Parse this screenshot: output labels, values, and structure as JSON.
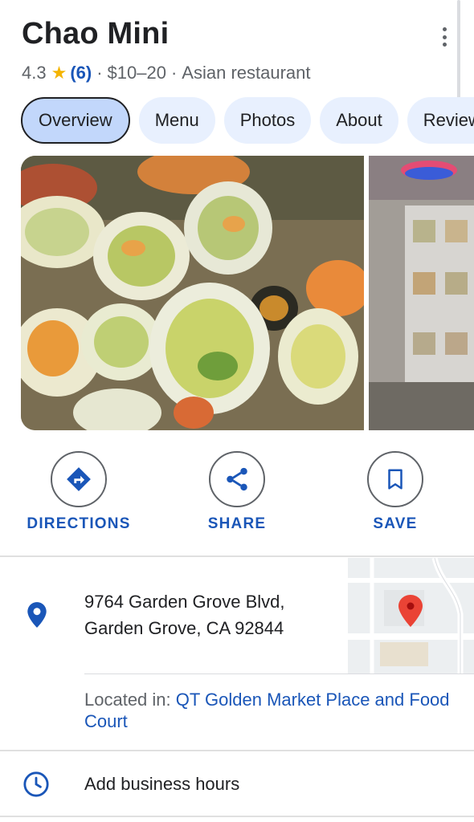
{
  "place": {
    "name": "Chao Mini",
    "rating": "4.3",
    "rating_star": "★",
    "review_count": "(6)",
    "separator": "·",
    "price_range": "$10–20",
    "category": "Asian restaurant"
  },
  "tabs": [
    {
      "label": "Overview",
      "active": true
    },
    {
      "label": "Menu",
      "active": false
    },
    {
      "label": "Photos",
      "active": false
    },
    {
      "label": "About",
      "active": false
    },
    {
      "label": "Reviews",
      "active": false
    }
  ],
  "actions": {
    "directions_label": "DIRECTIONS",
    "share_label": "SHARE",
    "save_label": "SAVE"
  },
  "address": {
    "line1": "9764 Garden Grove Blvd,",
    "line2": "Garden Grove, CA 92844",
    "located_prefix": "Located in: ",
    "located_place": "QT Golden Market Place and Food Court"
  },
  "hours": {
    "label": "Add business hours"
  },
  "icons": {
    "menu": "more-vert-icon",
    "directions": "directions-icon",
    "share": "share-icon",
    "save": "bookmark-icon",
    "location": "location-pin-icon",
    "hours": "clock-icon",
    "map_marker": "map-marker-icon"
  },
  "colors": {
    "accent": "#1a56b8",
    "star": "#f4b400",
    "tab_bg": "#e8f0fe",
    "tab_active_bg": "#c2d7fb",
    "map_pin": "#ea4335"
  }
}
